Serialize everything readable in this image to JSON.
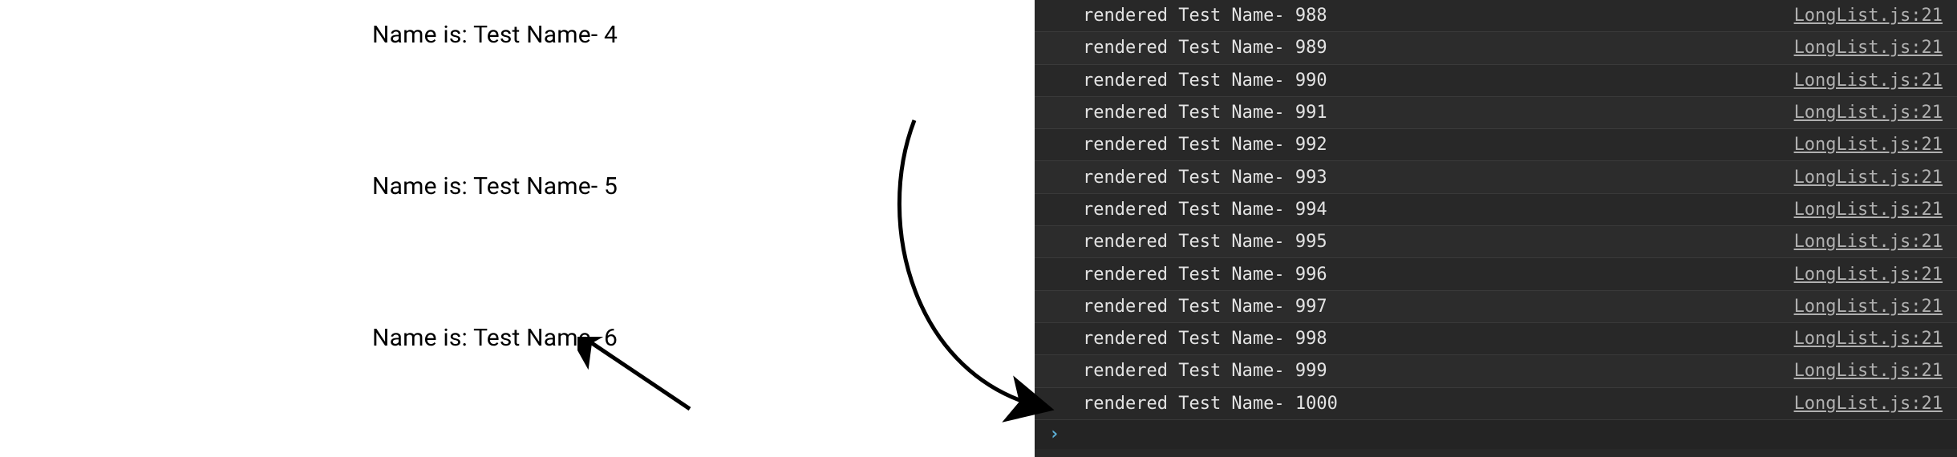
{
  "left": {
    "items": [
      {
        "label": "Name is: Test Name- 4"
      },
      {
        "label": "Name is: Test Name- 5"
      },
      {
        "label": "Name is: Test Name- 6"
      }
    ]
  },
  "console": {
    "source": "LongList.js:21",
    "prompt": "›",
    "rows": [
      {
        "msg": "rendered Test Name- 988"
      },
      {
        "msg": "rendered Test Name- 989"
      },
      {
        "msg": "rendered Test Name- 990"
      },
      {
        "msg": "rendered Test Name- 991"
      },
      {
        "msg": "rendered Test Name- 992"
      },
      {
        "msg": "rendered Test Name- 993"
      },
      {
        "msg": "rendered Test Name- 994"
      },
      {
        "msg": "rendered Test Name- 995"
      },
      {
        "msg": "rendered Test Name- 996"
      },
      {
        "msg": "rendered Test Name- 997"
      },
      {
        "msg": "rendered Test Name- 998"
      },
      {
        "msg": "rendered Test Name- 999"
      },
      {
        "msg": "rendered Test Name- 1000"
      }
    ]
  }
}
